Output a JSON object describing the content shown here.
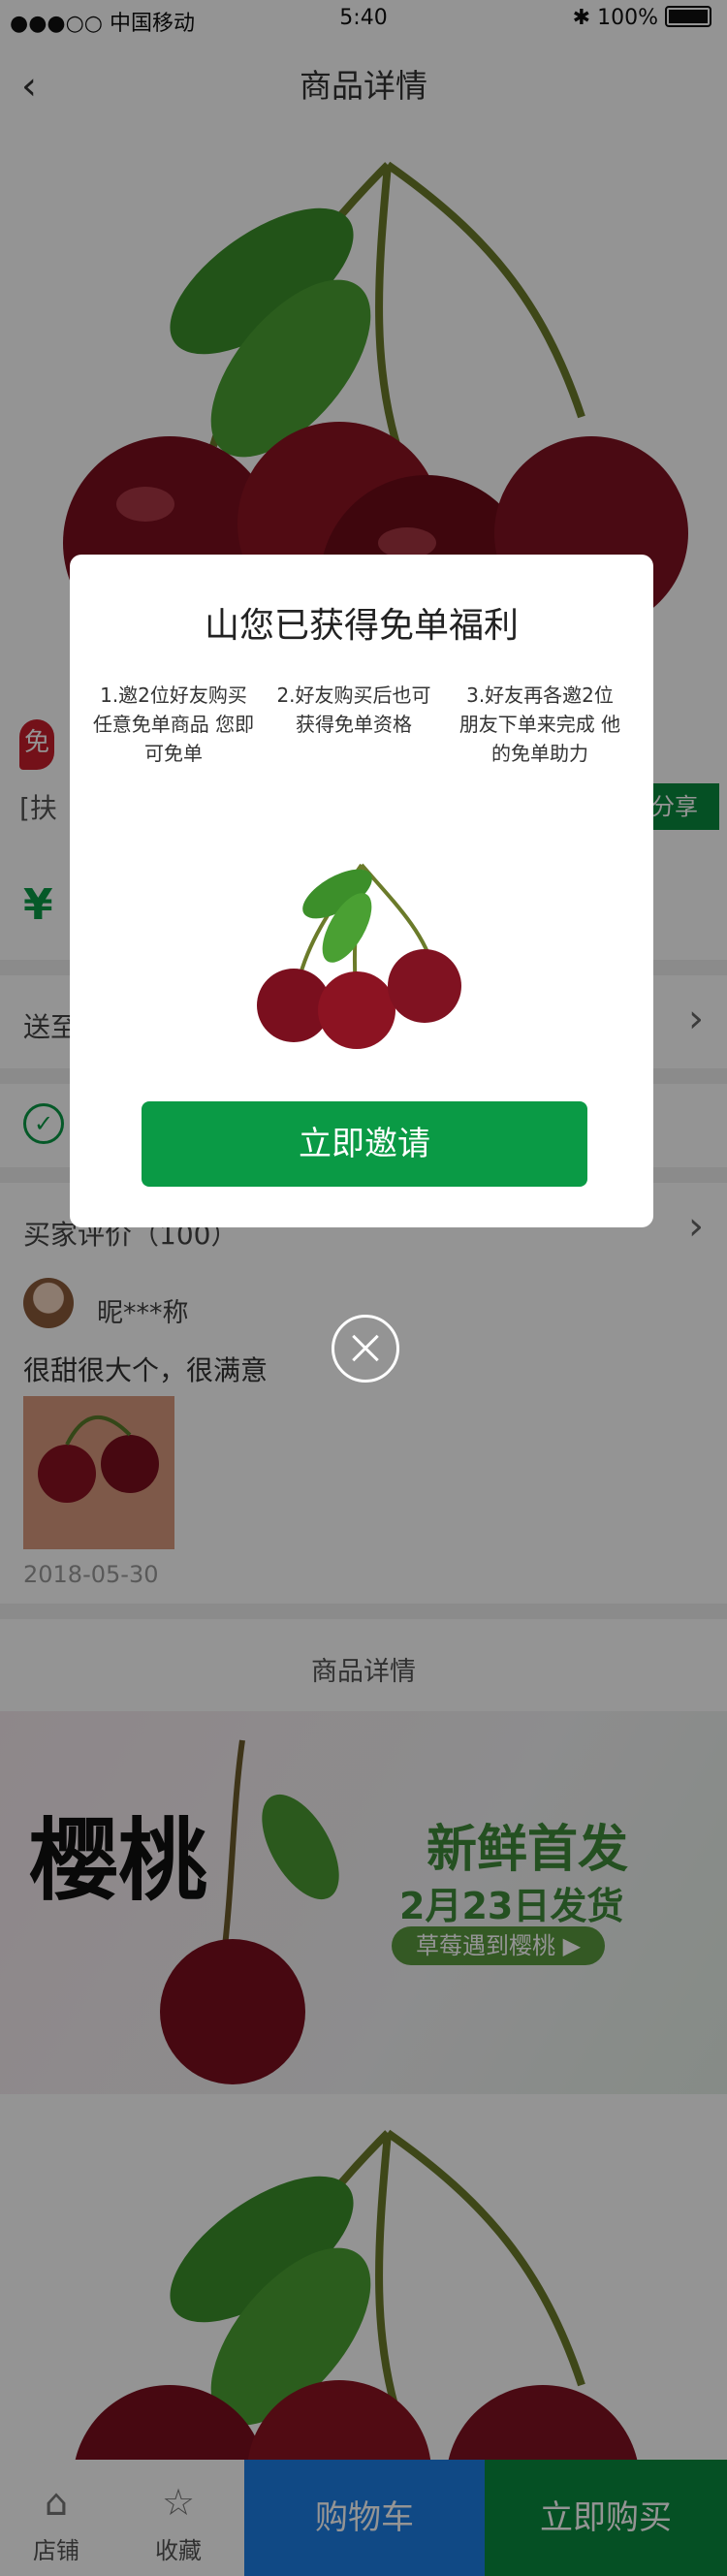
{
  "status_bar": {
    "carrier": "●●●○○ 中国移动",
    "time": "5:40",
    "battery": "100%"
  },
  "navbar": {
    "title": "商品详情"
  },
  "product": {
    "badge": "免",
    "subtitle": "[扶",
    "share_label": "分享",
    "price_symbol": "¥"
  },
  "rows": {
    "ship_label": "送至",
    "reviews_label": "买家评价（100）"
  },
  "review": {
    "reviewer": "昵***称",
    "text": "很甜很大个，很满意",
    "date": "2018-05-30"
  },
  "detail_title": "商品详情",
  "banner": {
    "yingtao": "樱桃",
    "xinxian": "新鲜首发",
    "date": "2月23日发货",
    "pill": "草莓遇到樱桃 ▶"
  },
  "tabbar": {
    "shop_label": "店铺",
    "fav_label": "收藏",
    "cart_label": "购物车",
    "buy_label": "立即购买"
  },
  "modal": {
    "title": "山您已获得免单福利",
    "steps": [
      "1.邀2位好友购买 任意免单商品 您即可免单",
      "2.好友购买后也可 获得免单资格",
      "3.好友再各邀2位 朋友下单来完成 他的免单助力"
    ],
    "invite_label": "立即邀请"
  },
  "colors": {
    "green": "#0a9a45",
    "blue": "#1d7ee6",
    "overlay": "rgba(0,0,0,0.42)"
  }
}
